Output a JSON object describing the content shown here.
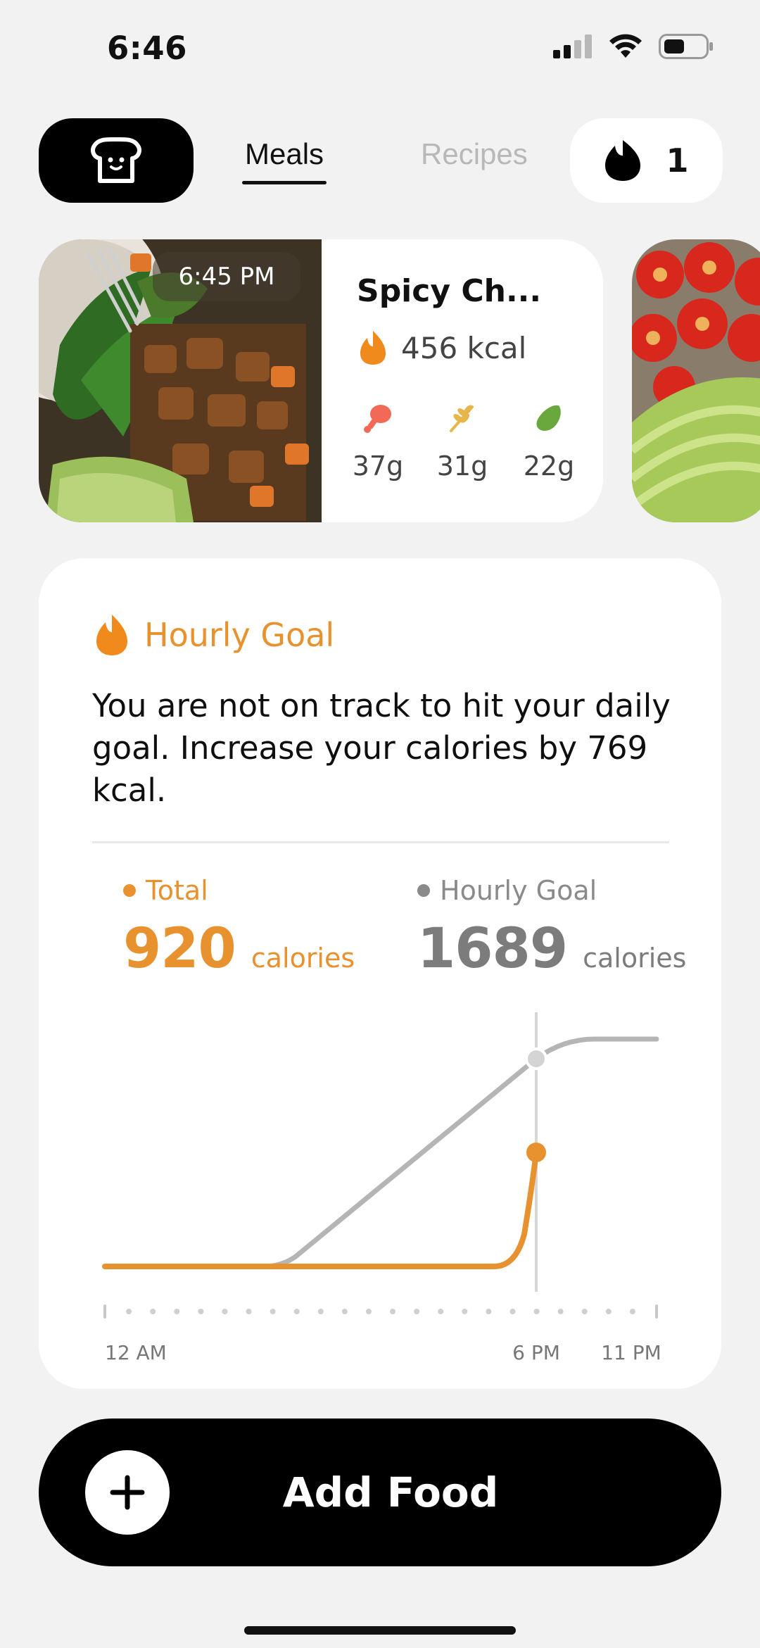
{
  "status_bar": {
    "time": "6:46"
  },
  "top_bar": {
    "tabs": [
      "Meals",
      "Recipes"
    ],
    "streak_count": "1"
  },
  "meal": {
    "time": "6:45 PM",
    "name": "Spicy Ch...",
    "kcal": "456 kcal",
    "macros": [
      {
        "icon": "drumstick-icon",
        "value": "37g",
        "color": "#f26a55"
      },
      {
        "icon": "wheat-icon",
        "value": "31g",
        "color": "#e6b64a"
      },
      {
        "icon": "avocado-icon",
        "value": "22g",
        "color": "#6aa83e"
      }
    ]
  },
  "goal": {
    "title": "Hourly Goal",
    "message": "You are not on track to hit your daily goal. Increase your calories by 769 kcal.",
    "total_label": "Total",
    "total_value": "920",
    "total_unit": "calories",
    "goal_label": "Hourly Goal",
    "goal_value": "1689",
    "goal_unit": "calories",
    "accent": "#e8922f",
    "goal_color": "#8a8a8a"
  },
  "chart_data": {
    "type": "line",
    "x_ticks": [
      "12 AM",
      "6 PM",
      "11 PM"
    ],
    "current_time": "6 PM",
    "series": [
      {
        "name": "Hourly Goal",
        "color": "#b5b5b5",
        "current_value": 1689
      },
      {
        "name": "Total",
        "color": "#e8922f",
        "current_value": 920
      }
    ]
  },
  "add_food": {
    "label": "Add Food"
  }
}
